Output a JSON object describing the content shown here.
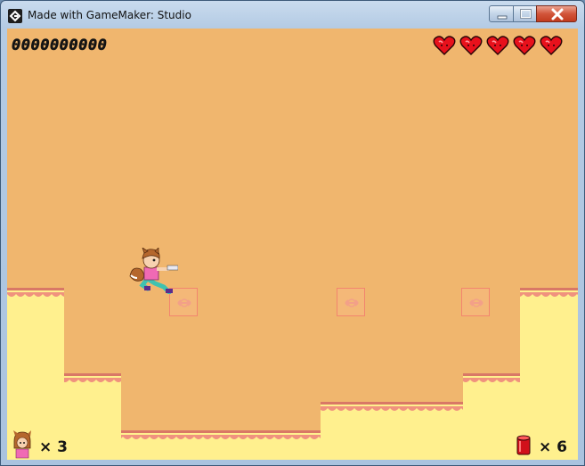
{
  "window": {
    "title": "Made with GameMaker: Studio"
  },
  "hud": {
    "score": "0000000000",
    "hearts": 5,
    "lives_label": "× 3",
    "ammo_label": "× 6"
  },
  "colors": {
    "sky": "#f0b66e",
    "ground_fill": "#fff08e",
    "ground_trim": "#f0927e",
    "heart_red": "#e8111c",
    "spring_border": "#f2856e"
  },
  "icons": {
    "app": "gamemaker-icon",
    "minimize": "minimize-icon",
    "maximize": "maximize-icon",
    "close": "close-icon",
    "heart": "heart-icon",
    "lives": "player-face-icon",
    "ammo": "ammo-canister-icon",
    "spring": "spring-arrows-icon"
  }
}
